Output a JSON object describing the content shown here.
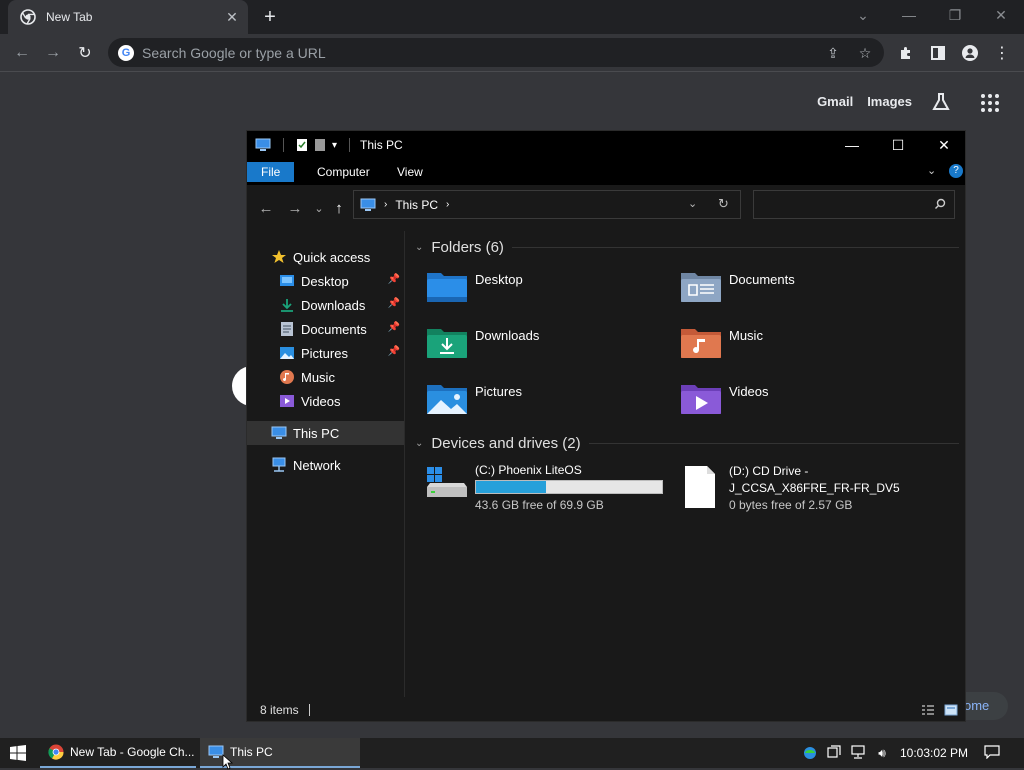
{
  "chrome": {
    "tab_title": "New Tab",
    "tab_close_icon": "close-icon",
    "new_tab_symbol": "+",
    "omnibox_placeholder": "Search Google or type a URL",
    "ntp_links": {
      "gmail": "Gmail",
      "images": "Images"
    },
    "partial_button_text": "ome"
  },
  "explorer": {
    "title": "This PC",
    "ribbon_tabs": [
      "File",
      "Computer",
      "View"
    ],
    "address_path": [
      "This PC"
    ],
    "navigation": [
      {
        "label": "Quick access",
        "icon": "star-icon",
        "pinned": false,
        "indent": 0
      },
      {
        "label": "Desktop",
        "icon": "desktop-folder-icon",
        "pinned": true,
        "indent": 1
      },
      {
        "label": "Downloads",
        "icon": "download-icon",
        "pinned": true,
        "indent": 1
      },
      {
        "label": "Documents",
        "icon": "documents-icon",
        "pinned": true,
        "indent": 1
      },
      {
        "label": "Pictures",
        "icon": "pictures-icon",
        "pinned": true,
        "indent": 1
      },
      {
        "label": "Music",
        "icon": "music-icon",
        "pinned": false,
        "indent": 1
      },
      {
        "label": "Videos",
        "icon": "videos-icon",
        "pinned": false,
        "indent": 1
      },
      {
        "label": "This PC",
        "icon": "computer-icon",
        "pinned": false,
        "indent": 0,
        "selected": true
      },
      {
        "label": "Network",
        "icon": "network-icon",
        "pinned": false,
        "indent": 0
      }
    ],
    "folders_header": "Folders (6)",
    "folders": [
      {
        "label": "Desktop",
        "icon": "desktop-folder-icon",
        "color": "#2b8ee8"
      },
      {
        "label": "Documents",
        "icon": "documents-folder-icon",
        "color": "#8ea6c4"
      },
      {
        "label": "Downloads",
        "icon": "downloads-folder-icon",
        "color": "#1aa37a"
      },
      {
        "label": "Music",
        "icon": "music-folder-icon",
        "color": "#e0784f"
      },
      {
        "label": "Pictures",
        "icon": "pictures-folder-icon",
        "color": "#2a8fe0"
      },
      {
        "label": "Videos",
        "icon": "videos-folder-icon",
        "color": "#8a5ad8"
      }
    ],
    "drives_header": "Devices and drives (2)",
    "drives": [
      {
        "label": "(C:) Phoenix LiteOS",
        "free_text": "43.6 GB free of 69.9 GB",
        "used_fraction": 0.376,
        "icon": "hard-drive-icon"
      },
      {
        "label": "(D:) CD Drive -",
        "label_line2": "J_CCSA_X86FRE_FR-FR_DV5",
        "free_text": "0 bytes free of 2.57 GB",
        "icon": "cd-drive-icon"
      }
    ],
    "status_items": "8 items"
  },
  "taskbar": {
    "items": [
      {
        "label": "New Tab - Google Ch...",
        "icon": "chrome-icon"
      },
      {
        "label": "This PC",
        "icon": "computer-icon"
      }
    ],
    "clock": "10:03:02 PM"
  },
  "colors": {
    "explorer_accent": "#1979ca",
    "drive_fill": "#26a0da",
    "chrome_frame": "#202124",
    "chrome_toolbar": "#35363a"
  }
}
